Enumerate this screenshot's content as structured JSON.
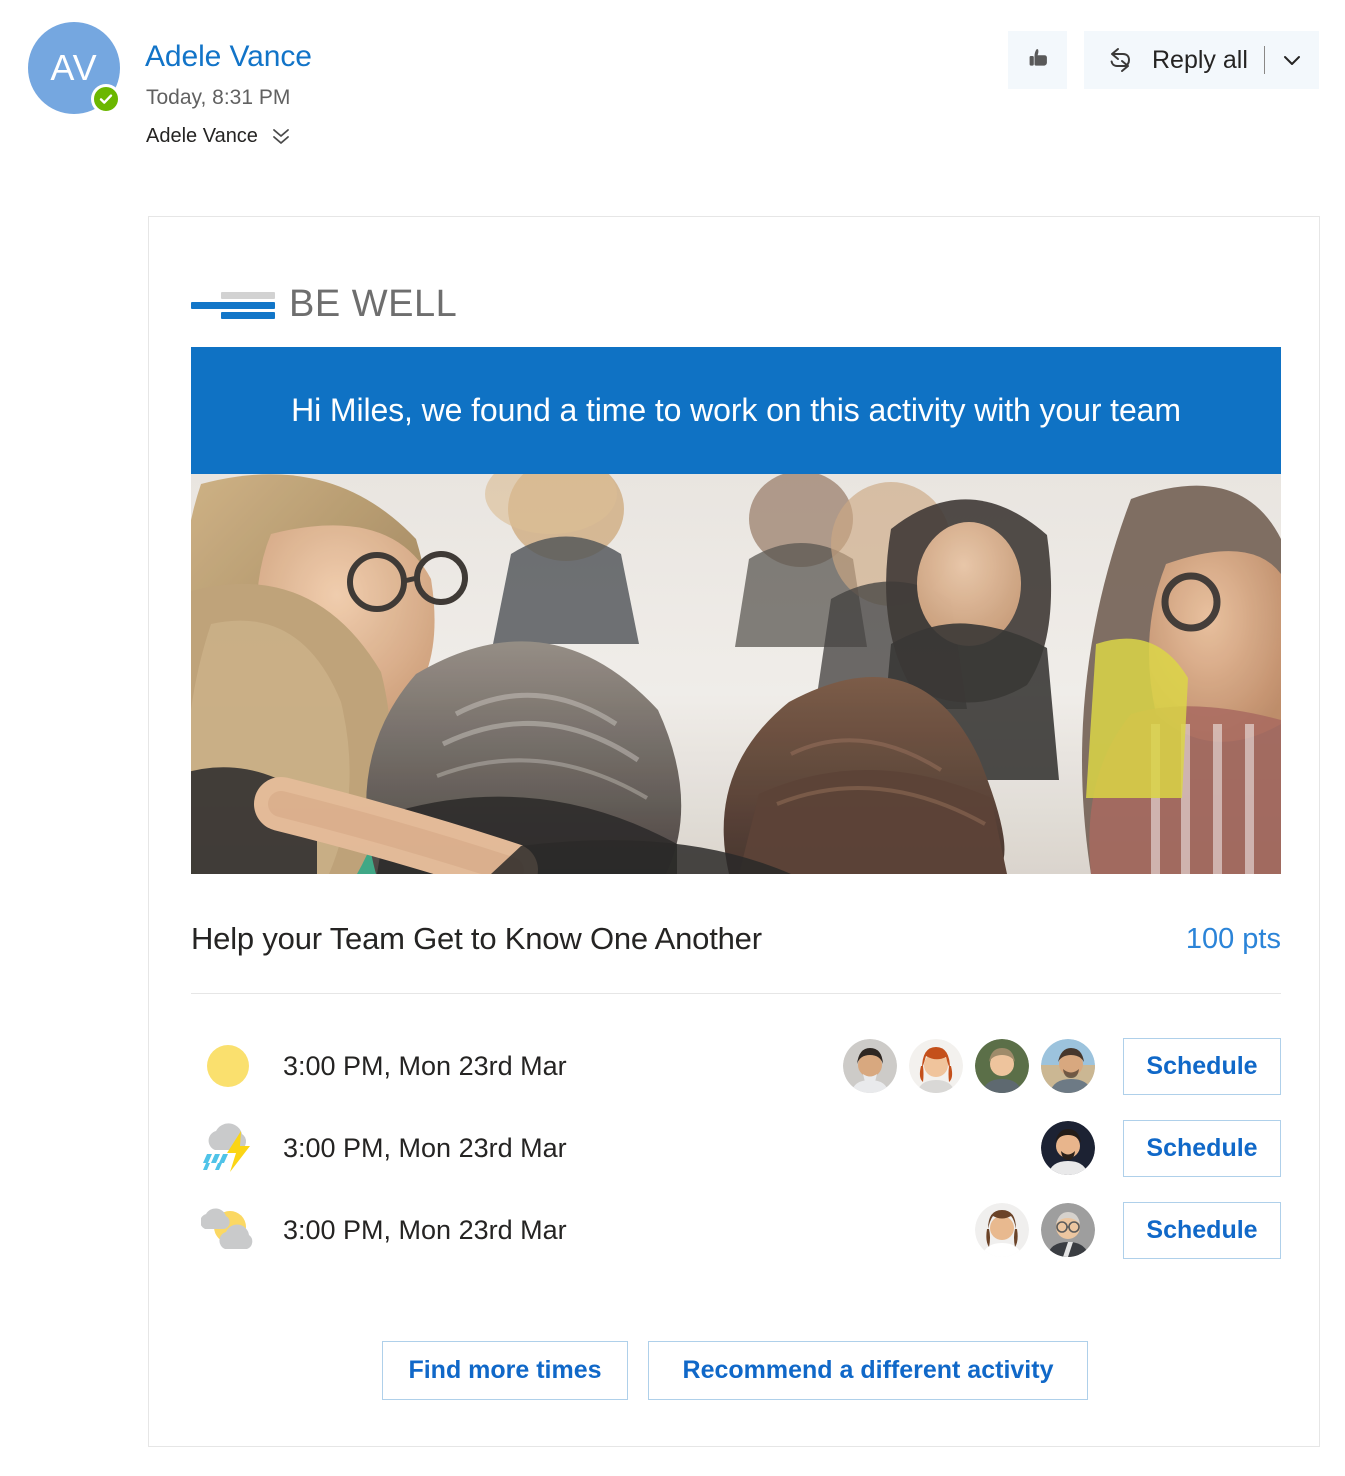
{
  "header": {
    "avatar_initials": "AV",
    "avatar_color": "#75A7E0",
    "presence_icon": "available-check-icon",
    "presence_color": "#6BB700",
    "sender_name": "Adele Vance",
    "sent_time": "Today, 8:31 PM",
    "recipient": "Adele Vance",
    "expand_icon": "chevron-double-down-icon",
    "like_icon": "thumbs-up-icon",
    "reply_all_icon": "reply-all-icon",
    "reply_all_label": "Reply all",
    "reply_all_caret_icon": "chevron-down-icon",
    "link_color": "#1274C8",
    "button_bg": "#F3F8FC"
  },
  "card": {
    "logo": {
      "text": "BE WELL",
      "bar_gray": "#D2D2D2",
      "bar_blue": "#1276C8"
    },
    "banner": {
      "text": "Hi Miles, we found a time to work on this activity with your team",
      "background": "#0F72C4",
      "text_color": "#FFFFFF"
    },
    "hero_image": {
      "alt": "group-of-people-embracing-photo"
    },
    "activity": {
      "title": "Help your Team Get to Know One Another",
      "points": "100 pts",
      "points_color": "#2B84D8"
    },
    "time_options": [
      {
        "weather_icon": "sunny-icon",
        "time": "3:00 PM, Mon 23rd Mar",
        "attendees": [
          "avatar-dark-haired-man",
          "avatar-red-haired-woman",
          "avatar-blonde-man",
          "avatar-bearded-man-beach"
        ],
        "button_label": "Schedule"
      },
      {
        "weather_icon": "thunderstorm-icon",
        "time": "3:00 PM, Mon 23rd Mar",
        "attendees": [
          "avatar-smiling-man-navy"
        ],
        "button_label": "Schedule"
      },
      {
        "weather_icon": "partly-cloudy-icon",
        "time": "3:00 PM, Mon 23rd Mar",
        "attendees": [
          "avatar-brown-haired-woman",
          "avatar-older-man-glasses"
        ],
        "button_label": "Schedule"
      }
    ],
    "footer_actions": {
      "find_more_times": "Find more times",
      "recommend_activity": "Recommend a different activity"
    },
    "accent_border": "#AFD0EA",
    "accent_text": "#1068C8"
  }
}
